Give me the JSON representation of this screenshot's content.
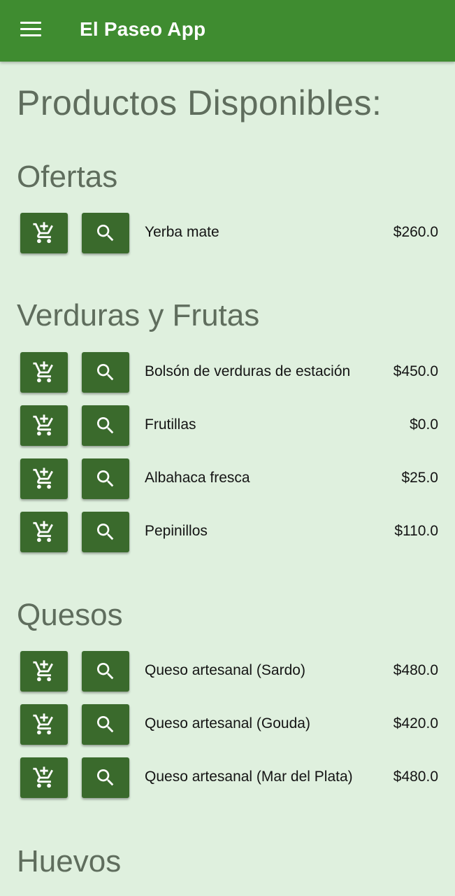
{
  "appbar": {
    "title": "El Paseo App",
    "menu_icon": "menu-icon",
    "color": "#3f8c30"
  },
  "page": {
    "title": "Productos Disponibles:",
    "background": "#dff0de"
  },
  "icons": {
    "add_to_cart": "add-shopping-cart-icon",
    "search": "search-icon"
  },
  "sections": [
    {
      "title": "Ofertas",
      "products": [
        {
          "name": "Yerba mate",
          "price": "$260.0"
        }
      ]
    },
    {
      "title": "Verduras y Frutas",
      "products": [
        {
          "name": "Bolsón de verduras de estación",
          "price": "$450.0"
        },
        {
          "name": "Frutillas",
          "price": "$0.0"
        },
        {
          "name": "Albahaca fresca",
          "price": "$25.0"
        },
        {
          "name": "Pepinillos",
          "price": "$110.0"
        }
      ]
    },
    {
      "title": "Quesos",
      "products": [
        {
          "name": "Queso artesanal (Sardo)",
          "price": "$480.0"
        },
        {
          "name": "Queso artesanal (Gouda)",
          "price": "$420.0"
        },
        {
          "name": "Queso artesanal (Mar del Plata)",
          "price": "$480.0"
        }
      ]
    },
    {
      "title": "Huevos",
      "products": []
    }
  ]
}
